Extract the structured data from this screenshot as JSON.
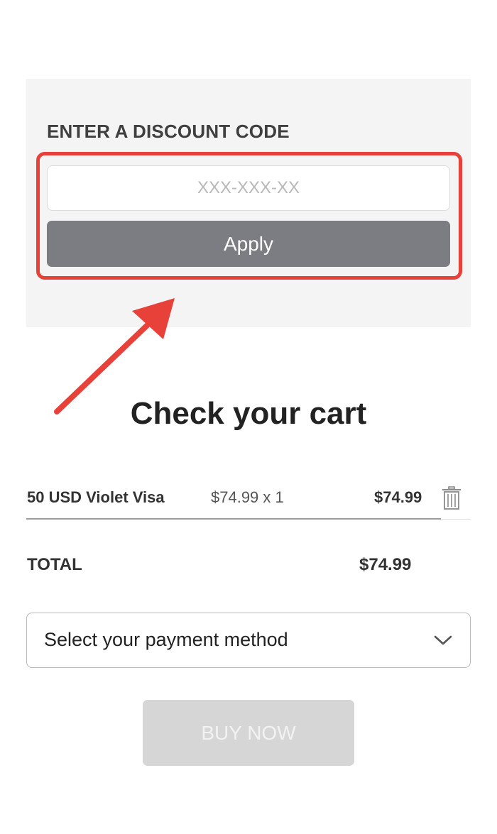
{
  "discount": {
    "title": "ENTER A DISCOUNT CODE",
    "input_value": "",
    "input_placeholder": "XXX-XXX-XX",
    "apply_label": "Apply"
  },
  "cart": {
    "title": "Check your cart",
    "items": [
      {
        "name": "50 USD Violet Visa",
        "unit_price_qty": "$74.99 x 1",
        "line_total": "$74.99",
        "remove_icon": "trash-icon"
      }
    ],
    "total_label": "TOTAL",
    "total_value": "$74.99"
  },
  "payment": {
    "select_label": "Select your payment method",
    "dropdown_icon": "chevron-down-icon"
  },
  "buy_now_label": "BUY NOW",
  "annotation": {
    "highlight_color": "#e8413a"
  },
  "colors": {
    "panel_background": "#f4f4f4",
    "apply_button": "#7c7d82",
    "buy_button_disabled": "#d6d6d6",
    "text_dark": "#222222"
  }
}
